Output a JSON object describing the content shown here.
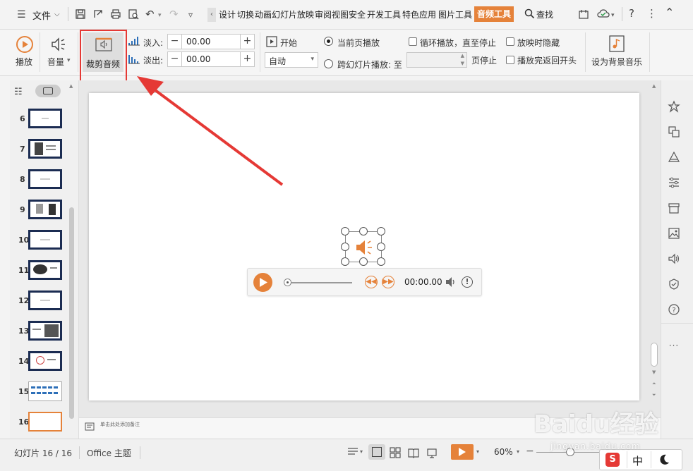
{
  "menubar": {
    "menu_label": "文件",
    "tabs": [
      "设计",
      "切换",
      "动画",
      "幻灯片放映",
      "审阅",
      "视图",
      "安全",
      "开发工具",
      "特色应用",
      "图片工具"
    ],
    "active_tab": "音频工具",
    "search_label": "查找"
  },
  "ribbon": {
    "play_label": "播放",
    "volume_label": "音量",
    "trim_label": "裁剪音频",
    "fade_in_label": "淡入:",
    "fade_in_value": "00.00",
    "fade_out_label": "淡出:",
    "fade_out_value": "00.00",
    "start_label": "开始",
    "start_select_value": "自动",
    "radio_current": "当前页播放",
    "radio_cross": "跨幻灯片播放: 至",
    "stop_page_label": "页停止",
    "check_loop": "循环播放，直至停止",
    "check_hide": "放映时隐藏",
    "check_rewind": "播放完返回开头",
    "bg_music_label": "设为背景音乐"
  },
  "slides_panel": {
    "slides": [
      {
        "num": "6"
      },
      {
        "num": "7"
      },
      {
        "num": "8"
      },
      {
        "num": "9"
      },
      {
        "num": "10"
      },
      {
        "num": "11"
      },
      {
        "num": "12"
      },
      {
        "num": "13"
      },
      {
        "num": "14"
      },
      {
        "num": "15"
      },
      {
        "num": "16"
      }
    ]
  },
  "player": {
    "time": "00:00.00"
  },
  "notes": {
    "placeholder": "单击此处添加备注"
  },
  "statusbar": {
    "slide_count": "幻灯片 16 / 16",
    "theme": "Office 主题",
    "zoom": "60%"
  },
  "ime": {
    "lang": "中"
  },
  "watermark": {
    "brand": "Baidu经验",
    "url": "jingyan.baidu.com"
  },
  "colors": {
    "accent": "#e5823a",
    "highlight_box": "#e53935",
    "arrow": "#e53935",
    "thumb_border": "#1b2c52",
    "active_thumb": "#e5823a"
  }
}
